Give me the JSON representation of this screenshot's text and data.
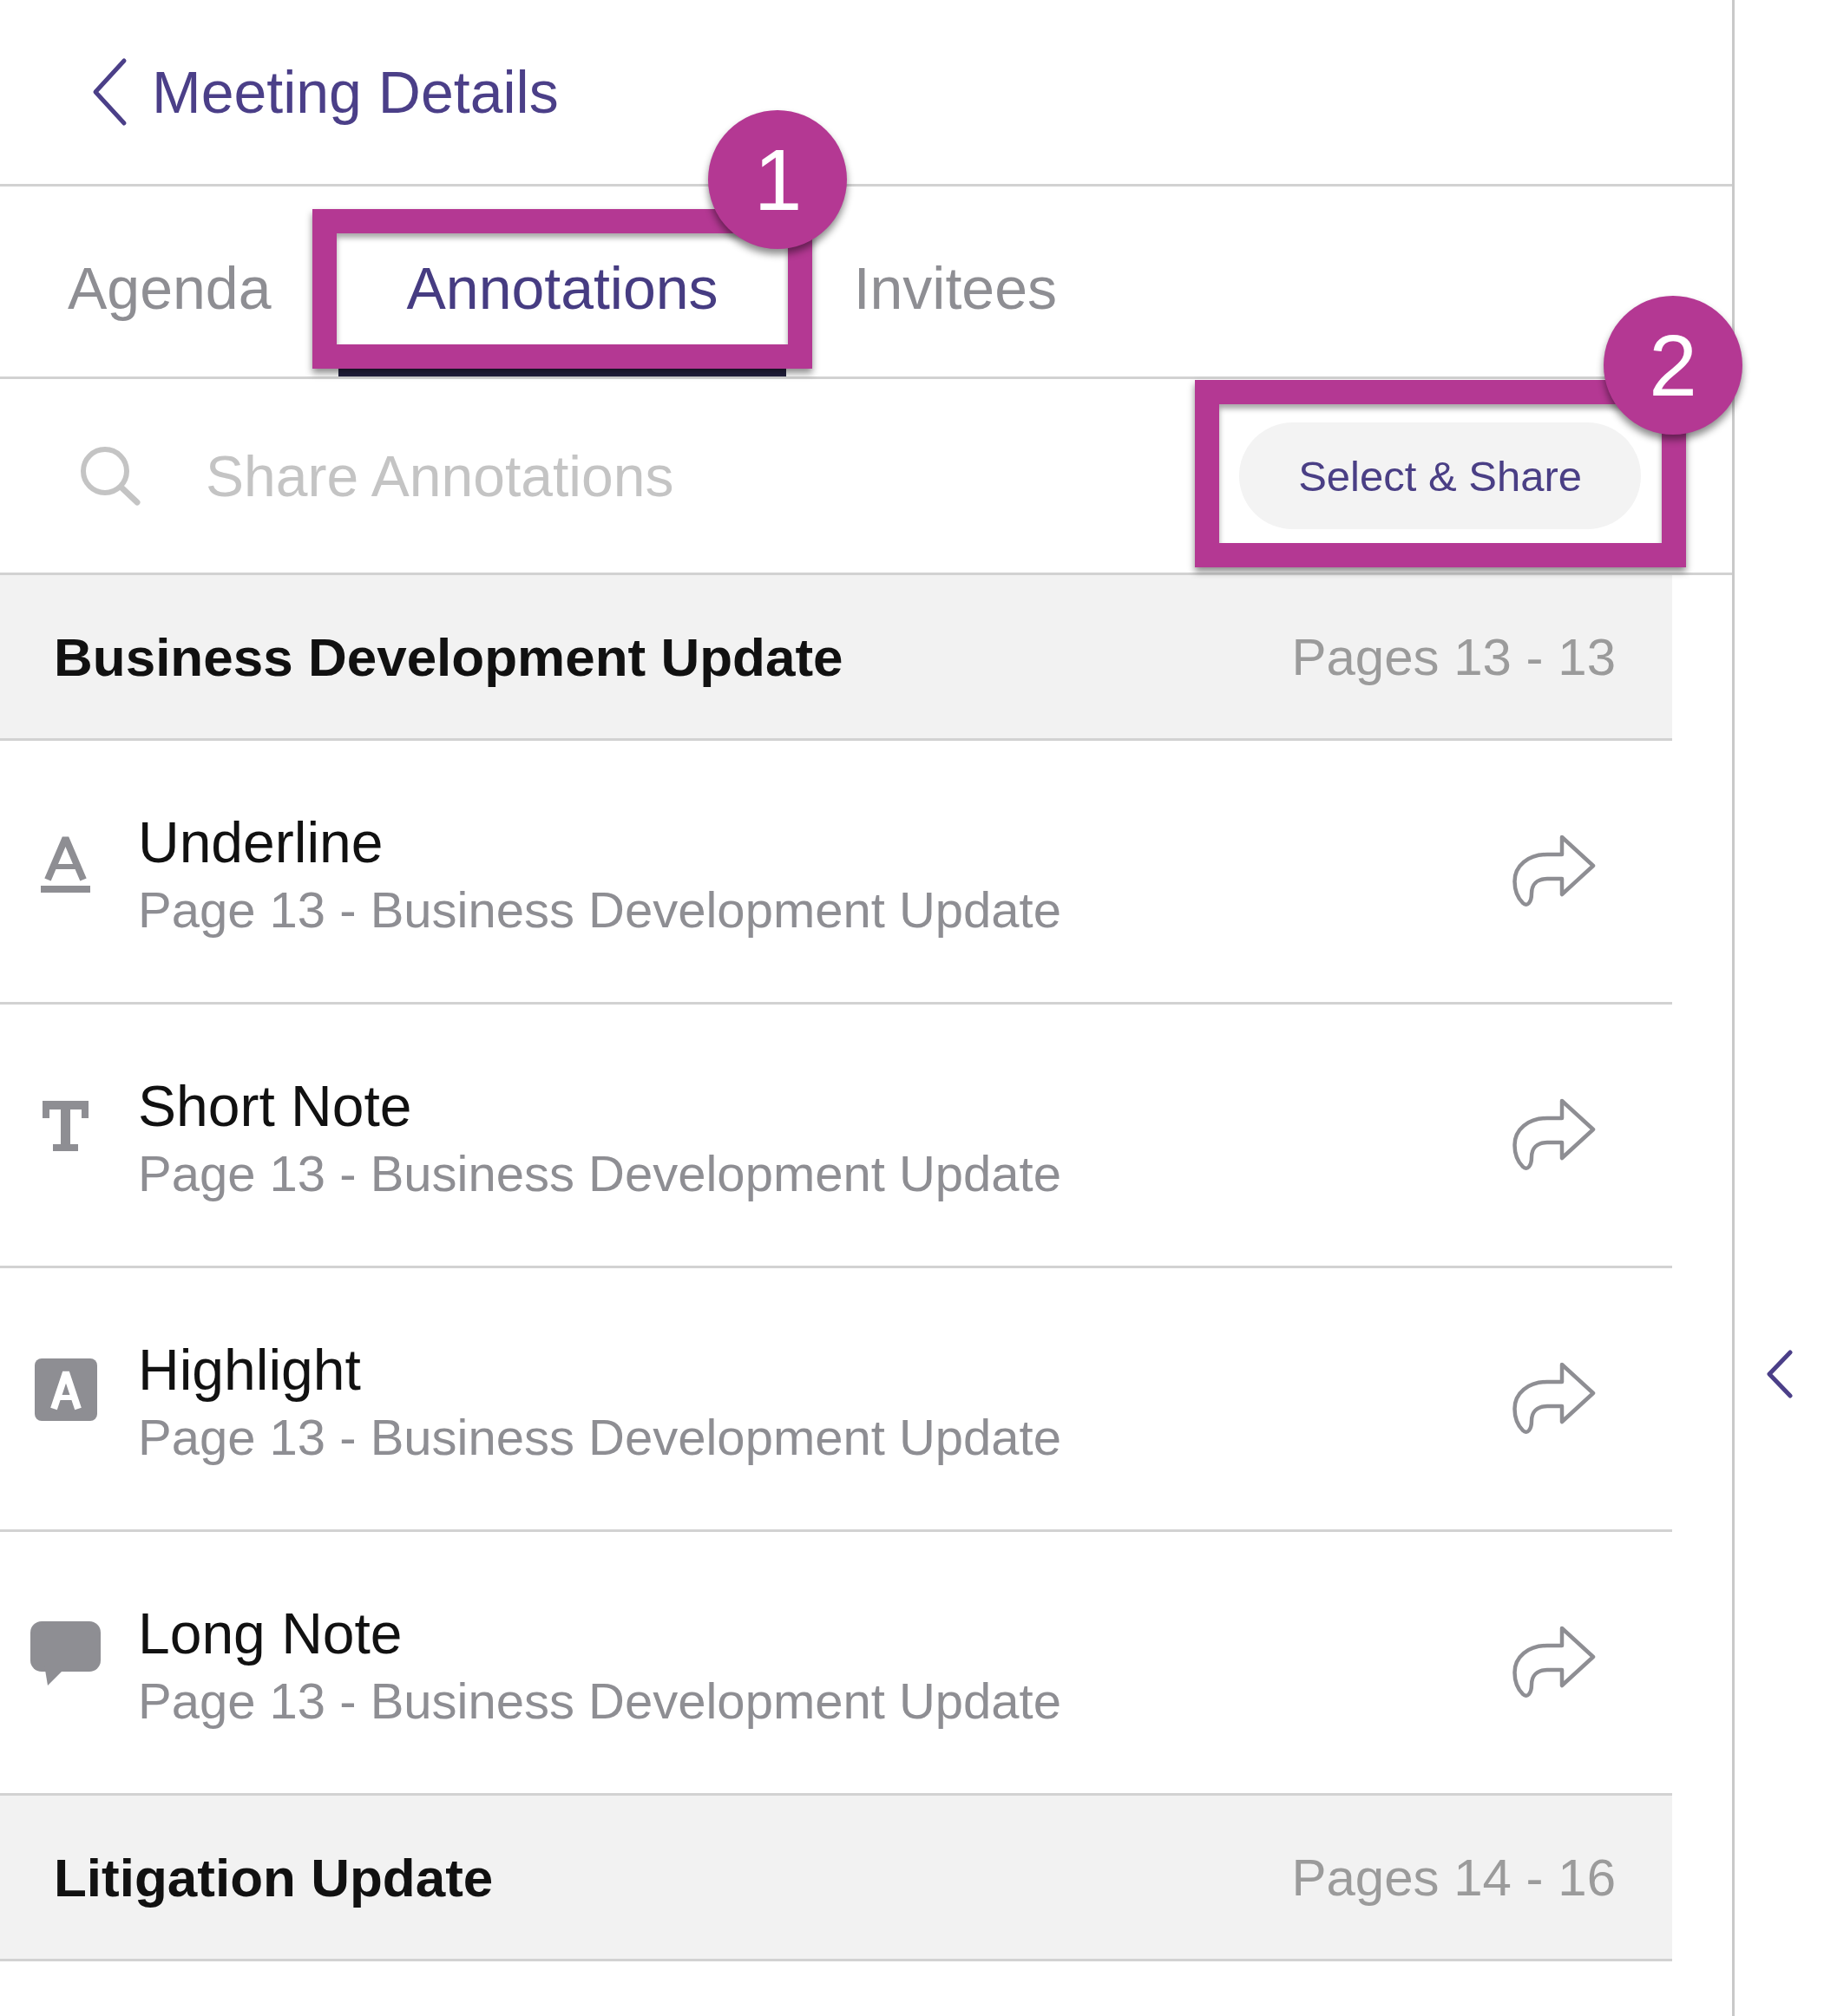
{
  "header": {
    "back_label": "Meeting Details"
  },
  "tabs": [
    {
      "label": "Agenda",
      "selected": false
    },
    {
      "label": "Annotations",
      "selected": true,
      "callout": "1"
    },
    {
      "label": "Invitees",
      "selected": false
    }
  ],
  "search": {
    "placeholder": "Share Annotations"
  },
  "share_button": {
    "label": "Select & Share",
    "callout": "2"
  },
  "sections": [
    {
      "title": "Business Development Update",
      "pages": "Pages 13 - 13",
      "annotations": [
        {
          "kind": "underline",
          "title": "Underline",
          "location": "Page 13 - Business Development Update"
        },
        {
          "kind": "text",
          "title": "Short Note",
          "location": "Page 13 - Business Development Update"
        },
        {
          "kind": "highlight",
          "title": "Highlight",
          "location": "Page 13 - Business Development Update"
        },
        {
          "kind": "comment",
          "title": "Long Note",
          "location": "Page 13 - Business Development Update"
        }
      ]
    },
    {
      "title": "Litigation Update",
      "pages": "Pages 14 - 16"
    }
  ]
}
